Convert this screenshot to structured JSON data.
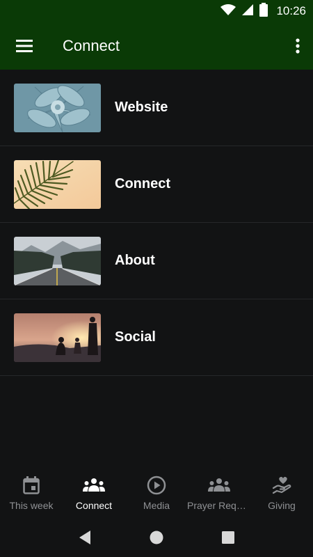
{
  "status_bar": {
    "time": "10:26",
    "icons": [
      "wifi-icon",
      "cell-signal-icon",
      "battery-icon"
    ]
  },
  "app_bar": {
    "title": "Connect",
    "menu_icon": "hamburger-menu-icon",
    "overflow_icon": "more-vertical-icon",
    "background": "#0a3a06"
  },
  "list": {
    "items": [
      {
        "label": "Website",
        "image": "succulent-thumbnail"
      },
      {
        "label": "Connect",
        "image": "palm-leaf-thumbnail"
      },
      {
        "label": "About",
        "image": "mountain-road-thumbnail"
      },
      {
        "label": "Social",
        "image": "sunset-people-thumbnail"
      }
    ]
  },
  "bottom_nav": {
    "items": [
      {
        "label": "This week",
        "icon": "calendar-icon",
        "active": false
      },
      {
        "label": "Connect",
        "icon": "people-group-icon",
        "active": true
      },
      {
        "label": "Media",
        "icon": "play-circle-icon",
        "active": false
      },
      {
        "label": "Prayer Requ…",
        "icon": "people-group-icon",
        "active": false
      },
      {
        "label": "Giving",
        "icon": "heart-hand-icon",
        "active": false
      }
    ]
  },
  "system_nav": {
    "icons": [
      "back-triangle-icon",
      "home-circle-icon",
      "recents-square-icon"
    ]
  },
  "colors": {
    "background": "#121314",
    "active": "#ffffff",
    "inactive": "#8f9194"
  }
}
